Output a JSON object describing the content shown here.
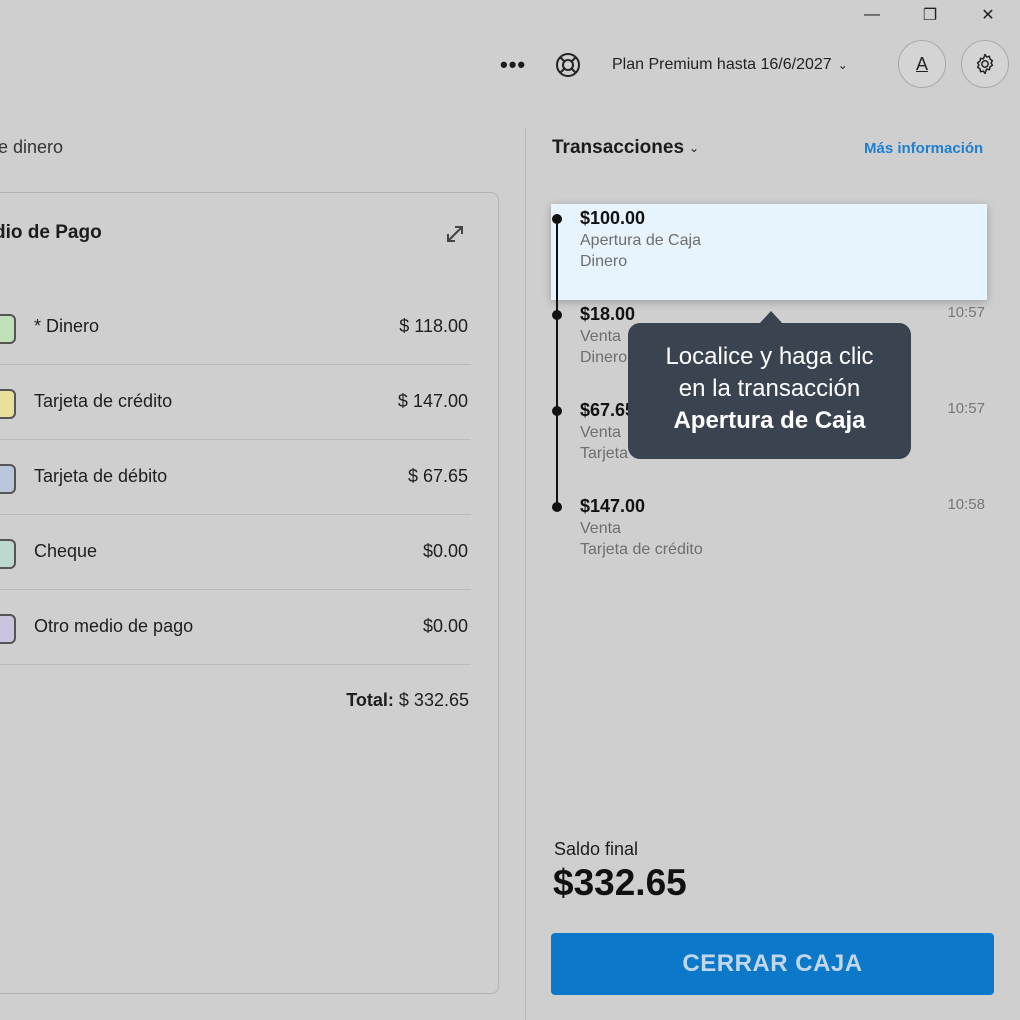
{
  "window": {
    "minimize_glyph": "—",
    "restore_glyph": "❐",
    "close_glyph": "✕"
  },
  "topbar": {
    "more_glyph": "•••",
    "plan_label": "Plan Premium hasta 16/6/2027",
    "plan_chevron": "⌄",
    "account_letter": "A",
    "icons": [
      "more-icon",
      "help-icon",
      "chevron-down-icon",
      "gear-icon"
    ]
  },
  "left": {
    "section_title": "e dinero",
    "card_title": "dio de Pago",
    "payment_methods": [
      {
        "name": "* Dinero",
        "amount": "$ 118.00",
        "color": "#bfe0b8"
      },
      {
        "name": "Tarjeta de crédito",
        "amount": "$ 147.00",
        "color": "#e8e09b"
      },
      {
        "name": "Tarjeta de débito",
        "amount": "$ 67.65",
        "color": "#b9c6db"
      },
      {
        "name": "Cheque",
        "amount": "$0.00",
        "color": "#bcd8cf"
      },
      {
        "name": "Otro medio de pago",
        "amount": "$0.00",
        "color": "#cbc4de"
      }
    ],
    "total_label": "Total:",
    "total_value": "$ 332.65"
  },
  "right": {
    "header": "Transacciones",
    "header_chevron": "⌄",
    "more_info": "Más información",
    "transactions": [
      {
        "amount": "$100.00",
        "type": "Apertura de Caja",
        "method": "Dinero",
        "time": ""
      },
      {
        "amount": "$18.00",
        "type": "Venta",
        "method": "Dinero",
        "time": "10:57"
      },
      {
        "amount": "$67.65",
        "type": "Venta",
        "method": "Tarjeta de débito",
        "time": "10:57"
      },
      {
        "amount": "$147.00",
        "type": "Venta",
        "method": "Tarjeta de crédito",
        "time": "10:58"
      }
    ],
    "tooltip": {
      "line1": "Localice y haga clic",
      "line2": "en la transacción",
      "line3": "Apertura de Caja"
    },
    "saldo_label": "Saldo final",
    "saldo_value": "$332.65",
    "close_button": "CERRAR CAJA"
  },
  "colors": {
    "background": "#cfcfcf",
    "accent": "#0b78c9",
    "link": "#1f7fd1",
    "highlight": "#e7f3fd",
    "tooltip_bg": "#3a4350"
  }
}
